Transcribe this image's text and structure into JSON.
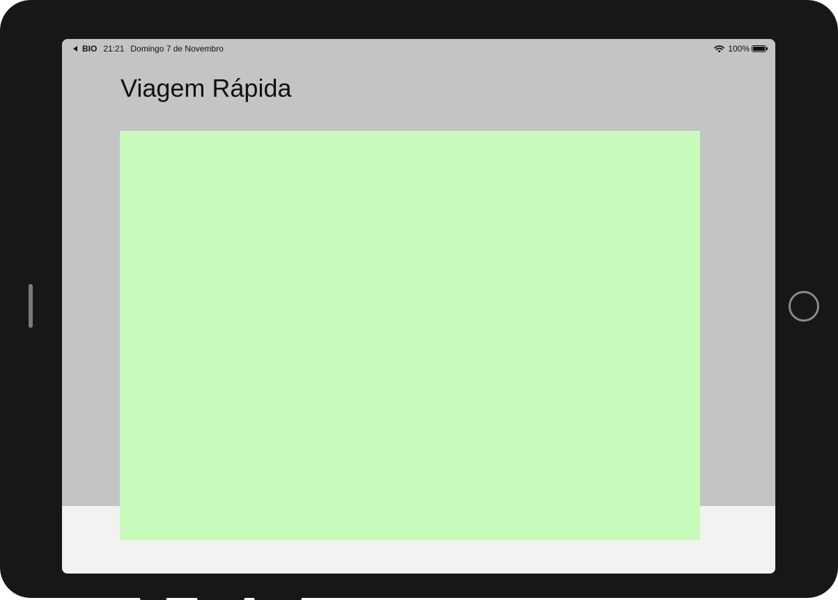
{
  "status_bar": {
    "back_app": "BIO",
    "time": "21:21",
    "date": "Domingo 7 de Novembro",
    "battery_percent": "100%",
    "icons": [
      "back-arrow-icon",
      "wifi-icon",
      "battery-icon"
    ]
  },
  "page": {
    "title": "Viagem Rápida"
  },
  "colors": {
    "device_bezel": "#171717",
    "screen_background": "#c4c4c4",
    "content_panel": "#c8fbbb",
    "bottom_area": "#f2f2f0"
  }
}
